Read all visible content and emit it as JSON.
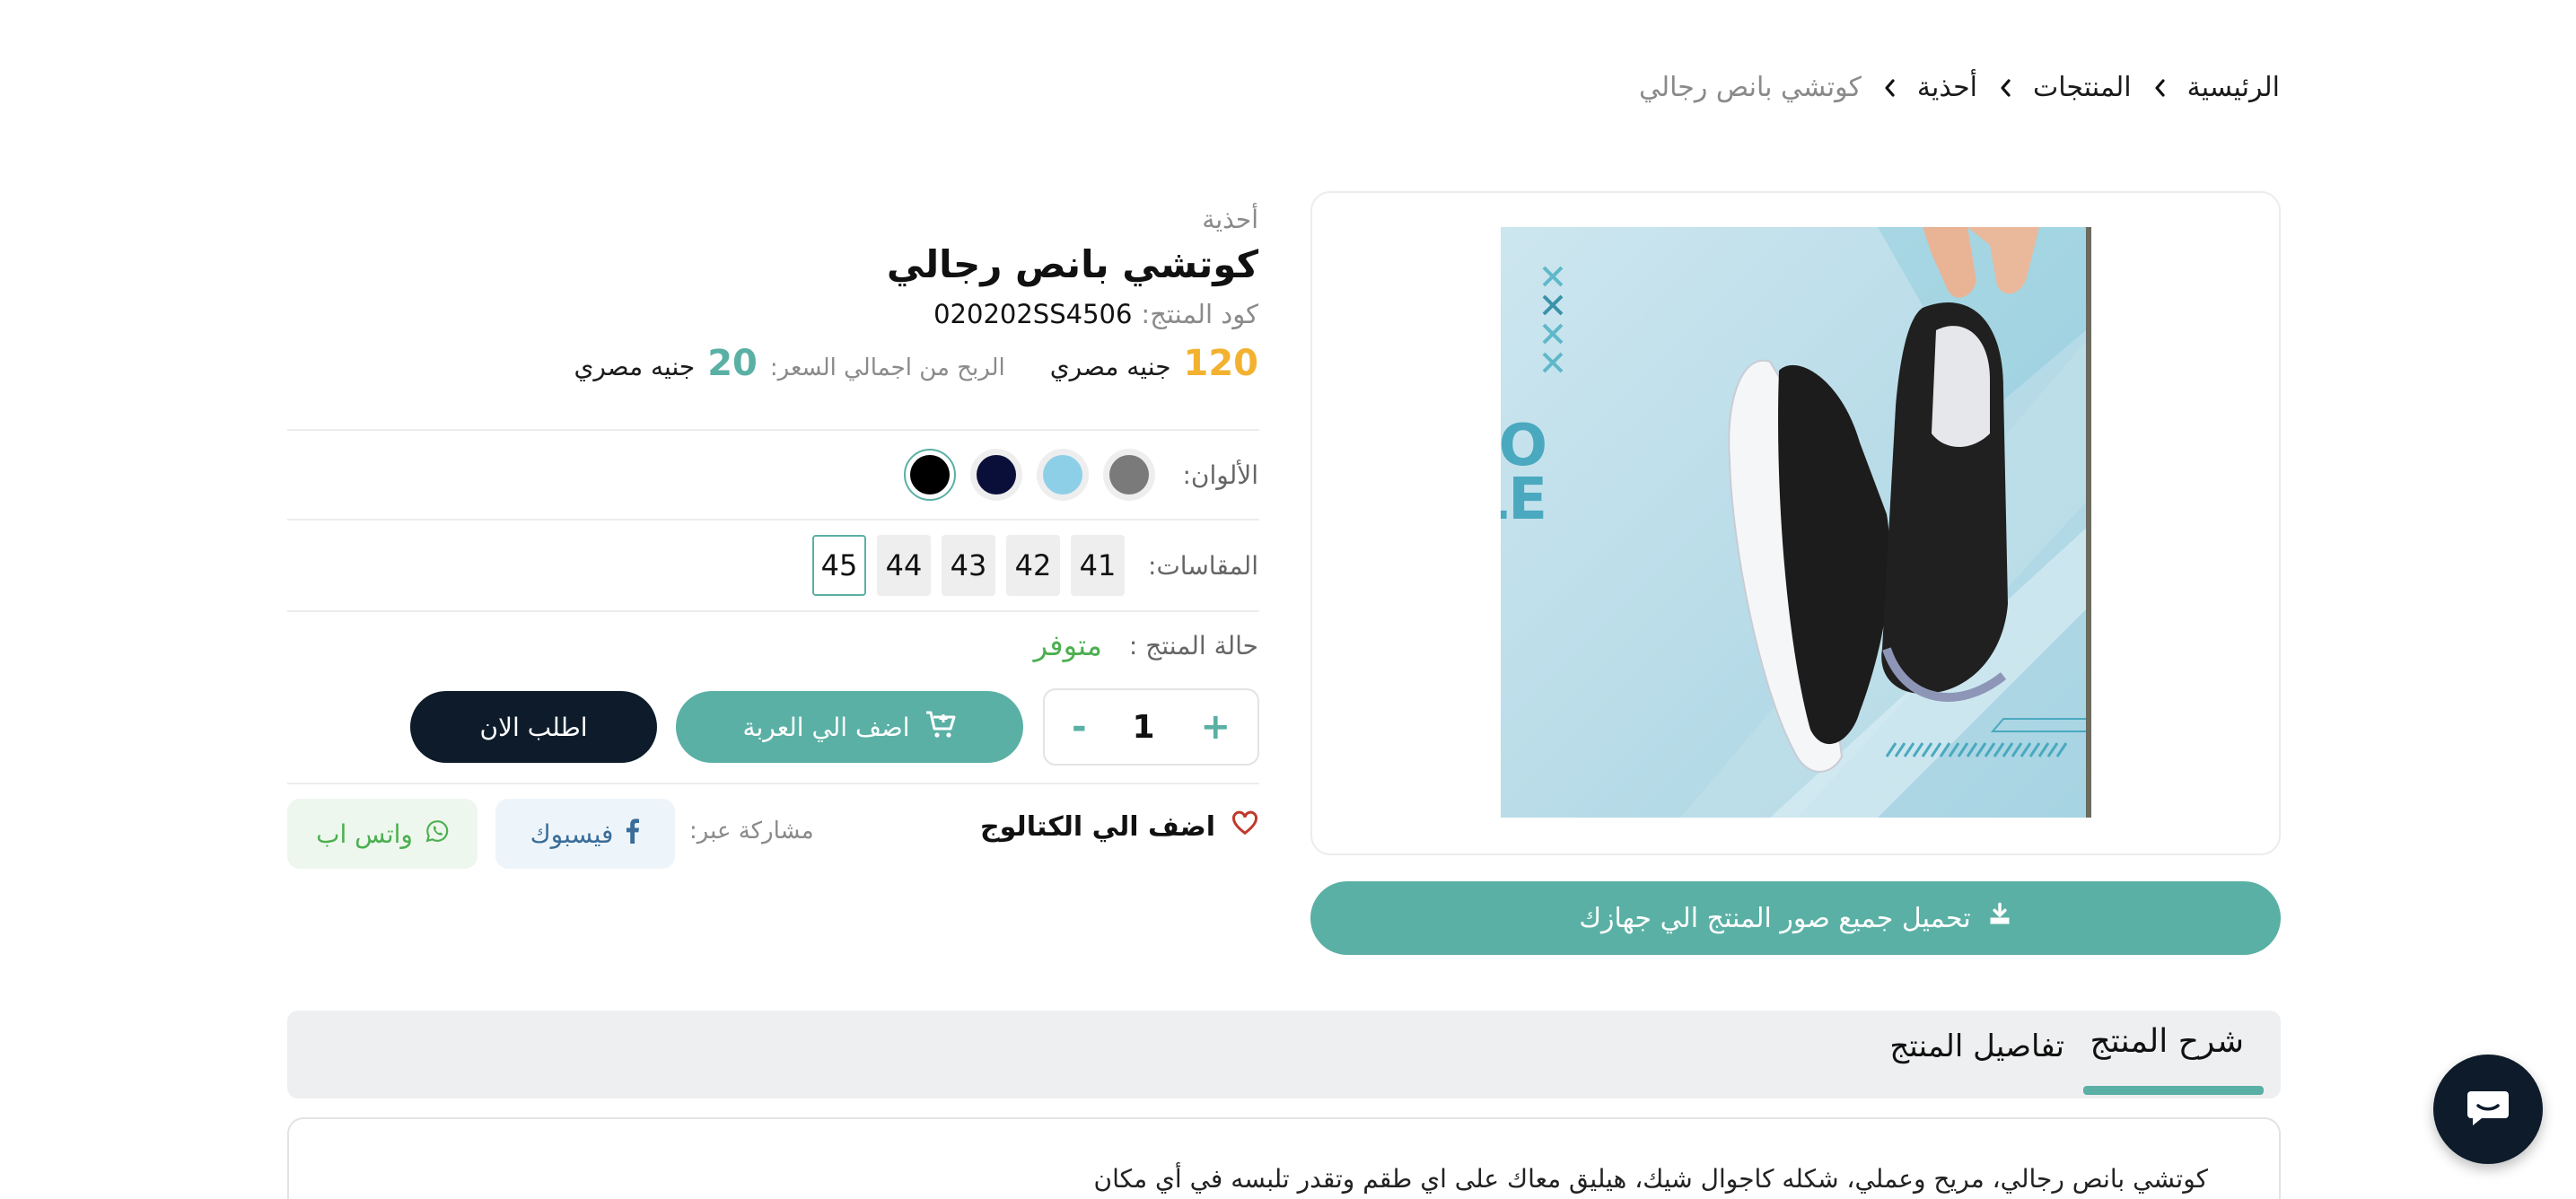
{
  "breadcrumb": {
    "items": [
      "الرئيسية",
      "المنتجات",
      "أحذية",
      "كوتشي بانص رجالي"
    ]
  },
  "image": {
    "overlay_text_line1": "COMFO",
    "overlay_text_line2": "RTABLE"
  },
  "download_button": {
    "label": "تحميل جميع صور المنتج الي جهازك"
  },
  "product": {
    "category": "أحذية",
    "title": "كوتشي بانص رجالي",
    "code_label": "كود المنتج:",
    "code_value": "020202SS4506",
    "price": "120",
    "price_currency": "جنيه مصري",
    "profit_label": "الربح من اجمالي السعر:",
    "profit": "20",
    "profit_currency": "جنيه مصري"
  },
  "colors": {
    "label": "الألوان:",
    "options": [
      "#7a7a7a",
      "#8ecfe8",
      "#0a0f3a",
      "#000000"
    ],
    "selected_index": 3
  },
  "sizes": {
    "label": "المقاسات:",
    "options": [
      "41",
      "42",
      "43",
      "44",
      "45"
    ],
    "selected": "45"
  },
  "status": {
    "label": "حالة المنتج :",
    "value": "متوفر"
  },
  "quantity": {
    "plus": "+",
    "value": "1",
    "minus": "-"
  },
  "actions": {
    "add_to_cart": "اضف الي العربة",
    "order_now": "اطلب الان",
    "add_to_catalog": "اضف الي الكتالوج",
    "share_label": "مشاركة عبر:",
    "facebook": "فيسبوك",
    "whatsapp": "واتس اب"
  },
  "tabs": {
    "description": "شرح المنتج",
    "details": "تفاصيل المنتج"
  },
  "description": {
    "text": "كوتشي بانص رجالي، مريح وعملي، شكله كاجوال شيك، هيليق معاك على اي طقم وتقدر تلبسه في أي مكان"
  },
  "colors_theme": {
    "accent": "#5ab0a4",
    "dark": "#0d1b2a",
    "price": "#f2b230",
    "available": "#4caf50"
  }
}
